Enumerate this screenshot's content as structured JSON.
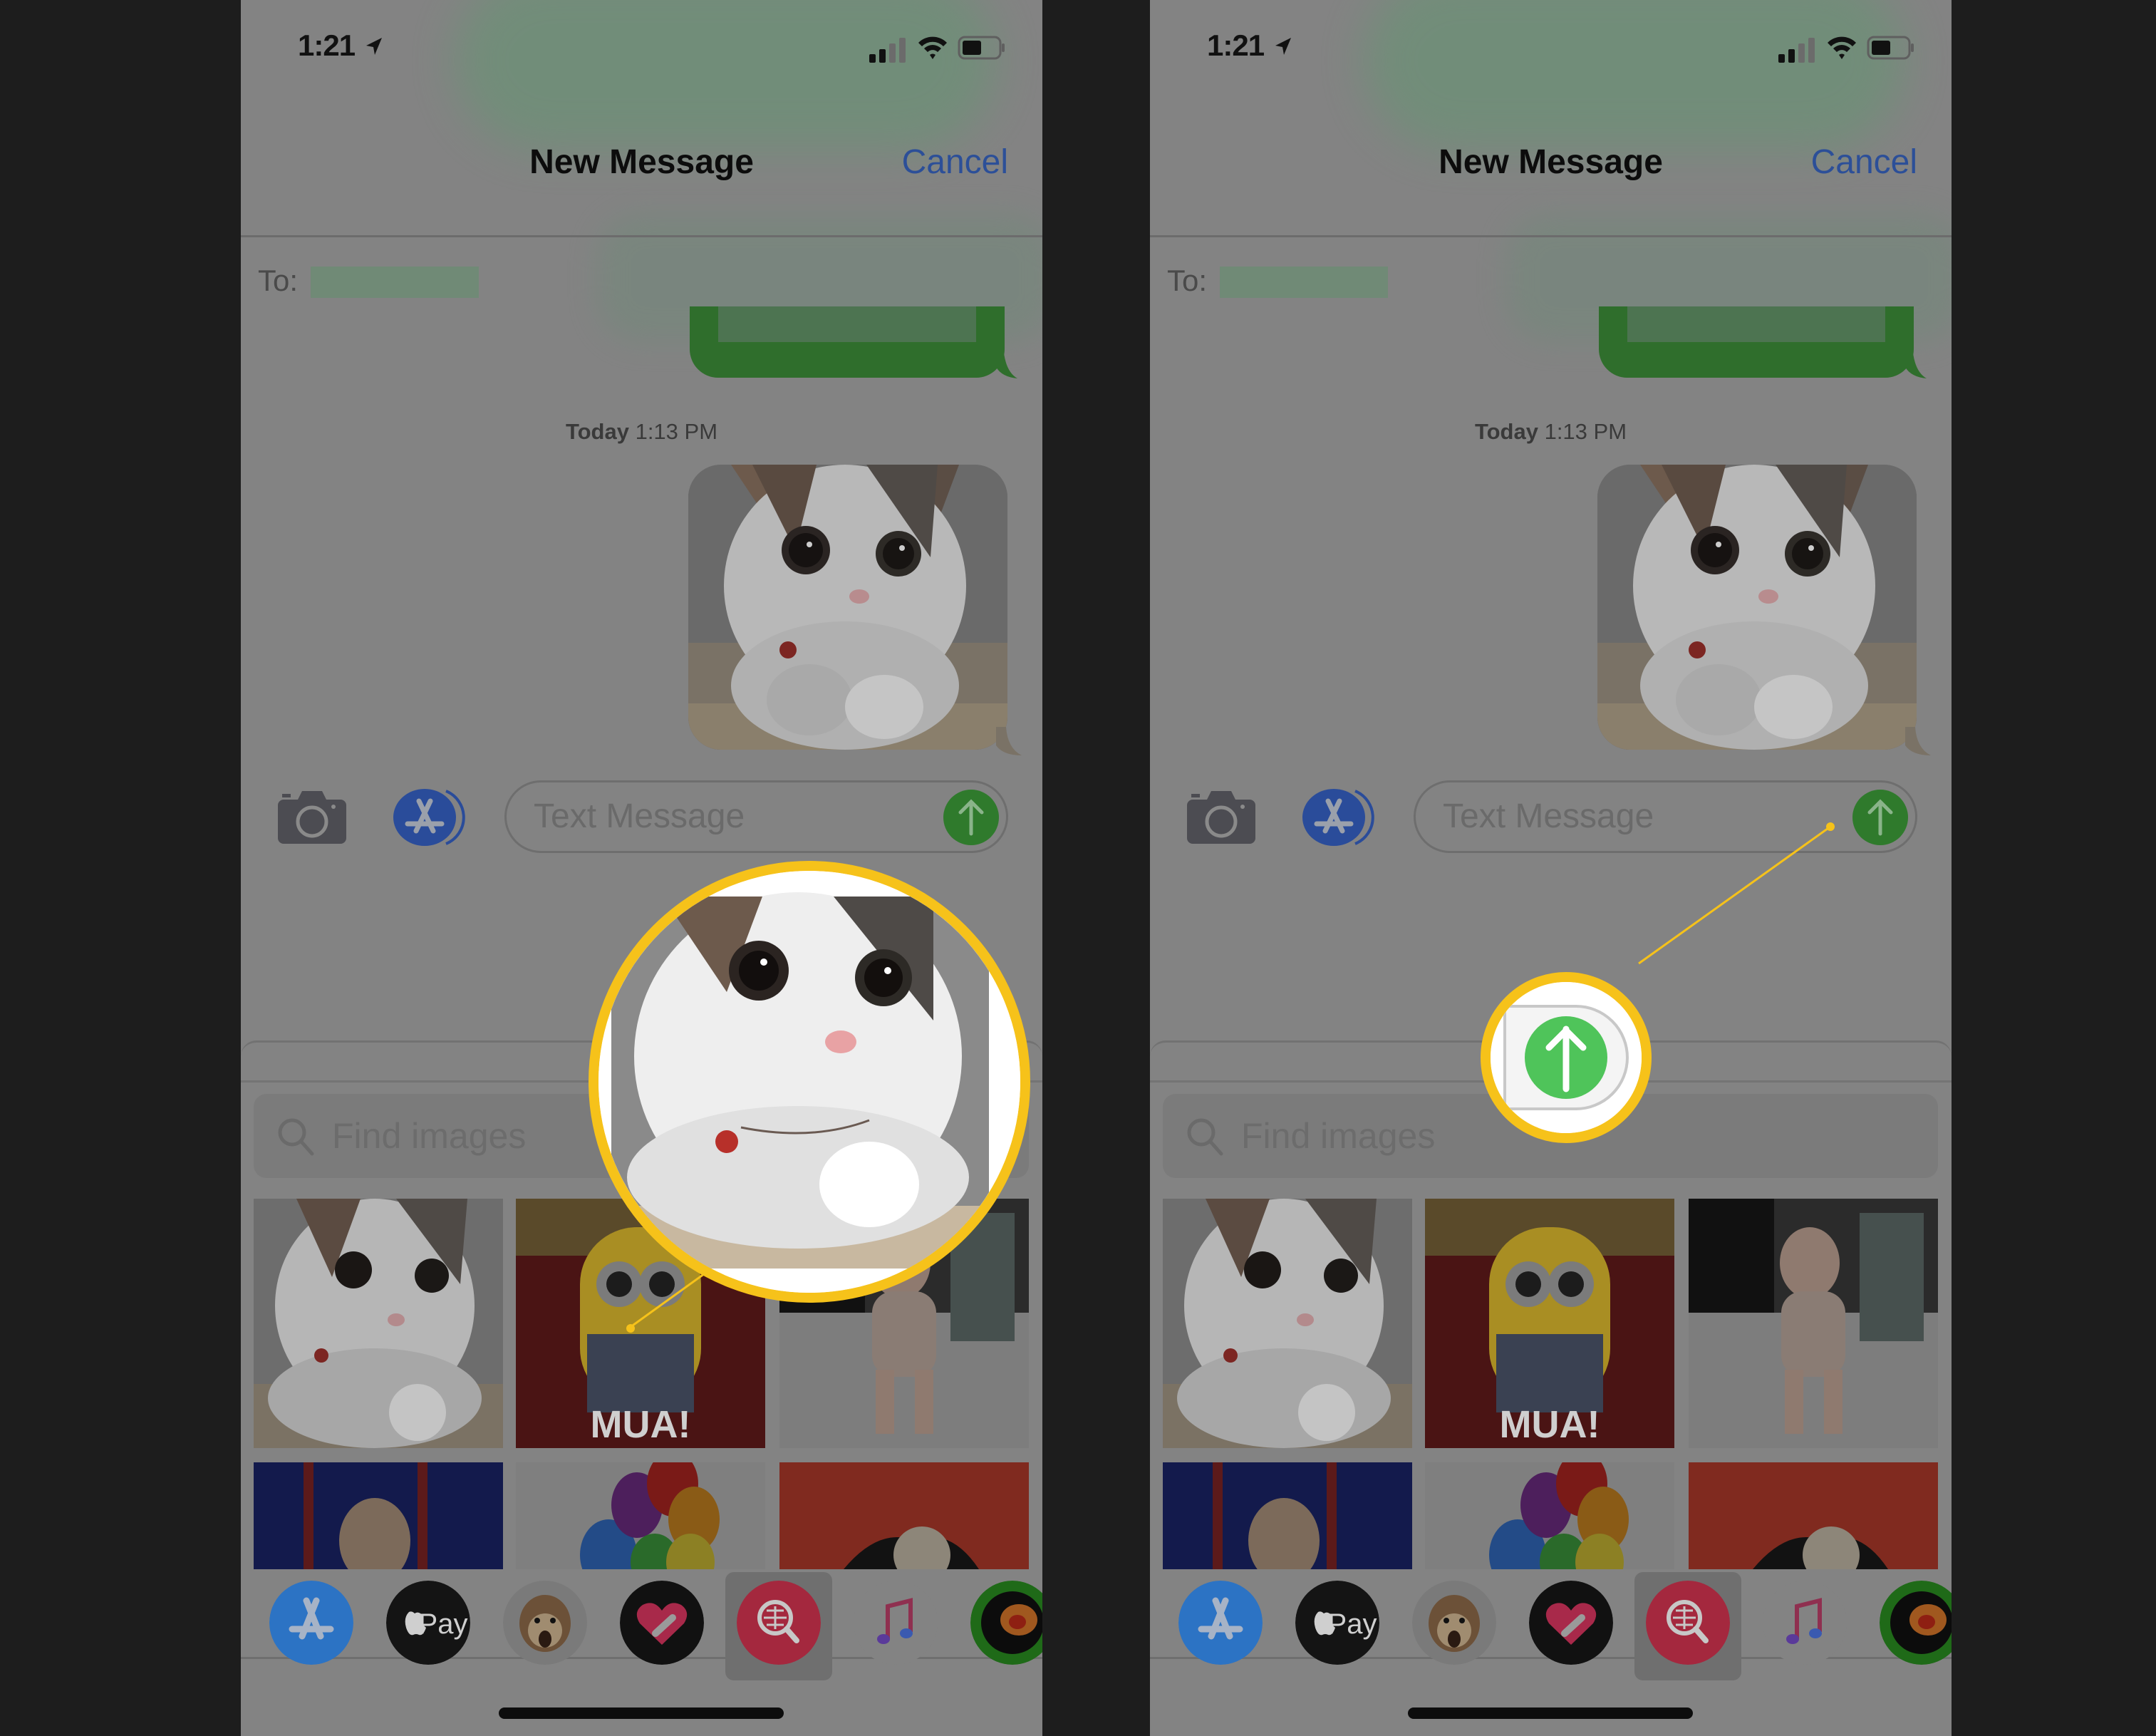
{
  "panels": [
    {
      "status": {
        "time": "1:21"
      },
      "nav": {
        "title": "New Message",
        "cancel": "Cancel"
      },
      "compose": {
        "to_label": "To:"
      },
      "thread": {
        "timestamp_day": "Today",
        "timestamp_time": "1:13 PM"
      },
      "input": {
        "placeholder": "Text Message"
      },
      "search": {
        "placeholder": "Find images"
      },
      "grid": {
        "tiles": [
          "Cat GIF",
          "Minion MUA! GIF",
          "Dancing baby GIF",
          "Girl on stage GIF",
          "Balloons GIF",
          "Red background GIF"
        ],
        "minion_caption": "MUA!"
      },
      "tray": {
        "apps": [
          "App Store",
          "Apple Pay",
          "Animoji",
          "Digital Touch",
          "#images",
          "Music",
          "Weather Radar"
        ],
        "selected": "#images",
        "applepay_label": "Pay"
      },
      "callout": {
        "target": "Cat GIF in image search results"
      }
    },
    {
      "status": {
        "time": "1:21"
      },
      "nav": {
        "title": "New Message",
        "cancel": "Cancel"
      },
      "compose": {
        "to_label": "To:"
      },
      "thread": {
        "timestamp_day": "Today",
        "timestamp_time": "1:13 PM"
      },
      "input": {
        "placeholder": "Text Message"
      },
      "search": {
        "placeholder": "Find images"
      },
      "grid": {
        "tiles": [
          "Cat GIF",
          "Minion MUA! GIF",
          "Dancing baby GIF",
          "Girl on stage GIF",
          "Balloons GIF",
          "Red background GIF"
        ],
        "minion_caption": "MUA!"
      },
      "tray": {
        "apps": [
          "App Store",
          "Apple Pay",
          "Animoji",
          "Digital Touch",
          "#images",
          "Music",
          "Weather Radar"
        ],
        "selected": "#images",
        "applepay_label": "Pay"
      },
      "callout": {
        "target": "Send button"
      }
    }
  ],
  "colors": {
    "highlight": "#f6c21a",
    "imessage_green": "#2f7a2c",
    "send_green": "#4fc45a",
    "link_blue": "#2c4f98",
    "background": "#1d1d1d"
  }
}
